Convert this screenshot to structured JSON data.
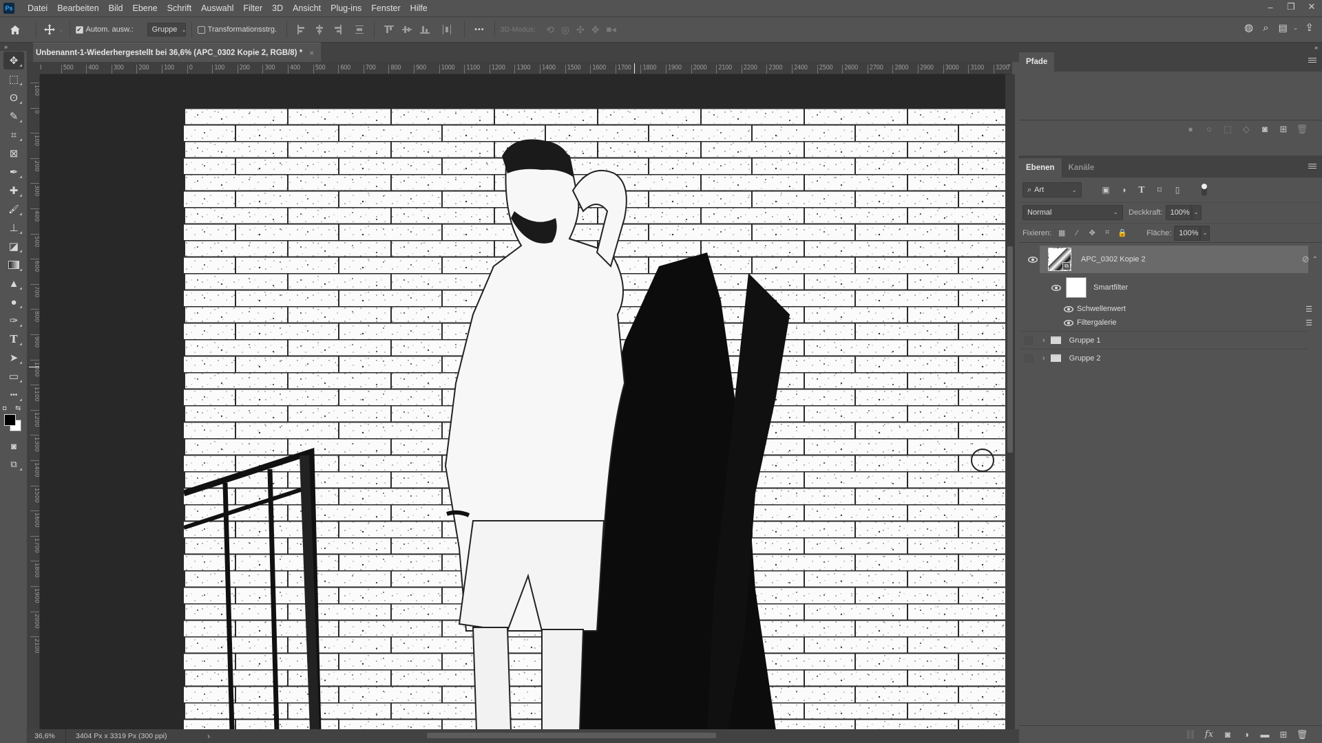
{
  "app": {
    "logo": "Ps",
    "menu": [
      "Datei",
      "Bearbeiten",
      "Bild",
      "Ebene",
      "Schrift",
      "Auswahl",
      "Filter",
      "3D",
      "Ansicht",
      "Plug-ins",
      "Fenster",
      "Hilfe"
    ],
    "window_controls": {
      "minimize": "–",
      "restore": "❐",
      "close": "✕"
    }
  },
  "options_bar": {
    "home_icon": "home-icon",
    "move_tool_icon": "move-icon",
    "auto_select_label": "Autom. ausw.:",
    "auto_select_checked": true,
    "auto_select_target": "Gruppe",
    "transform_controls_label": "Transformationsstrg.",
    "transform_controls_checked": false,
    "more_label": "•••",
    "mode_3d_label": "3D-Modus:"
  },
  "document": {
    "tab_title": "Unbenannt-1-Wiederhergestellt bei 36,6% (APC_0302 Kopie 2, RGB/8) *",
    "close_label": "×",
    "ruler_h_labels": [
      "0",
      "500",
      "400",
      "300",
      "200",
      "100",
      "0",
      "100",
      "200",
      "300",
      "400",
      "500",
      "600",
      "700",
      "800",
      "900",
      "1000",
      "1100",
      "1200",
      "1300",
      "1400",
      "1500",
      "1600",
      "1700",
      "1800",
      "1900",
      "2000",
      "2100",
      "2200",
      "2300",
      "2400",
      "2500",
      "2600",
      "2700",
      "2800",
      "2900",
      "3000",
      "3100",
      "3200"
    ],
    "ruler_v_labels": [
      "100",
      "0",
      "100",
      "200",
      "300",
      "400",
      "500",
      "600",
      "700",
      "800",
      "900",
      "1000",
      "1100",
      "1200",
      "1300",
      "1400",
      "1500",
      "1600",
      "1700",
      "1800",
      "1900",
      "2000",
      "2100"
    ]
  },
  "status": {
    "zoom": "36,6%",
    "doc_size": "3404 Px x 3319 Px (300 ppi)",
    "arrow": "›"
  },
  "tools": [
    {
      "name": "move-tool",
      "glyph": "✥"
    },
    {
      "name": "marquee-tool",
      "glyph": "⬚"
    },
    {
      "name": "lasso-tool",
      "glyph": "ʘ"
    },
    {
      "name": "quick-selection-tool",
      "glyph": "✎"
    },
    {
      "name": "crop-tool",
      "glyph": "⌗"
    },
    {
      "name": "frame-tool",
      "glyph": "⊠"
    },
    {
      "name": "eyedropper-tool",
      "glyph": "✒"
    },
    {
      "name": "healing-brush-tool",
      "glyph": "✚"
    },
    {
      "name": "brush-tool",
      "glyph": "🖌"
    },
    {
      "name": "clone-stamp-tool",
      "glyph": "⊥"
    },
    {
      "name": "eraser-tool",
      "glyph": "◪"
    },
    {
      "name": "gradient-tool",
      "glyph": "▮"
    },
    {
      "name": "blur-tool",
      "glyph": "▲"
    },
    {
      "name": "dodge-tool",
      "glyph": "●"
    },
    {
      "name": "pen-tool",
      "glyph": "✑"
    },
    {
      "name": "type-tool",
      "glyph": "T"
    },
    {
      "name": "path-selection-tool",
      "glyph": "➤"
    },
    {
      "name": "rectangle-tool",
      "glyph": "▭"
    },
    {
      "name": "more-tools",
      "glyph": "•••"
    }
  ],
  "paths_panel": {
    "tab": "Pfade"
  },
  "layers_panel": {
    "tabs": [
      "Ebenen",
      "Kanäle"
    ],
    "filter_kind": "Art",
    "blend_mode": "Normal",
    "opacity_label": "Deckkraft:",
    "opacity_value": "100%",
    "lock_label": "Fixieren:",
    "fill_label": "Fläche:",
    "fill_value": "100%",
    "layers": [
      {
        "name": "APC_0302 Kopie 2",
        "visible": true,
        "selected": true,
        "type": "smart-object"
      },
      {
        "name": "Smartfilter",
        "visible": true,
        "type": "smart-filter-mask"
      },
      {
        "name": "Schwellenwert",
        "visible": true,
        "type": "filter"
      },
      {
        "name": "Filtergalerie",
        "visible": true,
        "type": "filter"
      },
      {
        "name": "Gruppe 1",
        "visible": false,
        "type": "group"
      },
      {
        "name": "Gruppe 2",
        "visible": false,
        "type": "group"
      }
    ]
  }
}
